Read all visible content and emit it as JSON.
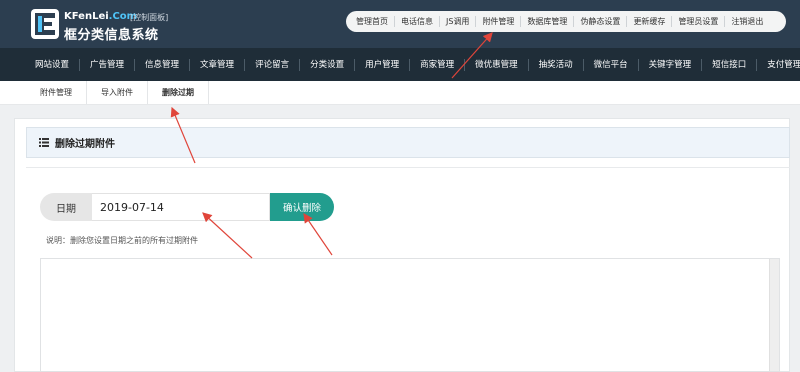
{
  "brand": {
    "en_prefix": "KFenLei",
    "en_suffix": ".Com",
    "tag": "[控制面板]",
    "cn": "框分类信息系统"
  },
  "top_links": [
    "管理首页",
    "电话信息",
    "JS调用",
    "附件管理",
    "数据库管理",
    "伪静态设置",
    "更新缓存",
    "管理员设置",
    "注销退出"
  ],
  "main_nav": [
    "网站设置",
    "广告管理",
    "信息管理",
    "文章管理",
    "评论留言",
    "分类设置",
    "用户管理",
    "商家管理",
    "微优惠管理",
    "抽奖活动",
    "微信平台",
    "关键字管理",
    "短信接口",
    "支付管理"
  ],
  "sub_nav": [
    {
      "label": "附件管理",
      "active": false
    },
    {
      "label": "导入附件",
      "active": false
    },
    {
      "label": "删除过期",
      "active": true
    }
  ],
  "panel": {
    "title": "删除过期附件"
  },
  "form": {
    "date_label": "日期",
    "date_value": "2019-07-14",
    "confirm_label": "确认删除",
    "hint": "说明：删除您设置日期之前的所有过期附件"
  },
  "colors": {
    "header_bg": "#2c3e50",
    "nav_bg": "#1f2d38",
    "accent": "#229d8e",
    "annotation_arrow": "#e0453a"
  },
  "icons": {
    "logo": "logo-icon",
    "panel_title": "list-icon"
  }
}
